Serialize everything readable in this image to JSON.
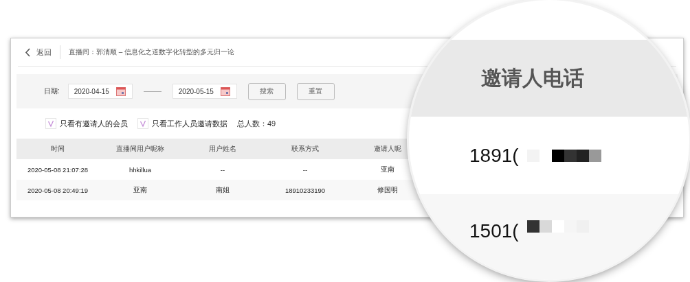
{
  "header": {
    "back_label": "返回",
    "title": "直播间：郭清顺 – 信息化之道数字化转型的多元归一论"
  },
  "filter": {
    "date_label": "日期:",
    "date_from": "2020-04-15",
    "date_to": "2020-05-15",
    "buttons": [
      "搜索",
      "重置"
    ]
  },
  "options": [
    {
      "label": "只看有邀请人的会员",
      "checked": true
    },
    {
      "label": "只看工作人员邀请数据",
      "checked": true
    }
  ],
  "total": "总人数：49",
  "table": {
    "columns": [
      "时间",
      "直播间用户昵称",
      "用户姓名",
      "联系方式",
      "邀请人昵"
    ],
    "rows": [
      [
        "2020-05-08 21:07:28",
        "hhkillua",
        "--",
        "--",
        "亚南"
      ],
      [
        "2020-05-08 20:49:19",
        "亚南",
        "南姐",
        "18910233190",
        "修国明"
      ]
    ]
  },
  "magnifier": {
    "column": "邀请人电话",
    "cells": [
      "1891(",
      "1501("
    ]
  }
}
